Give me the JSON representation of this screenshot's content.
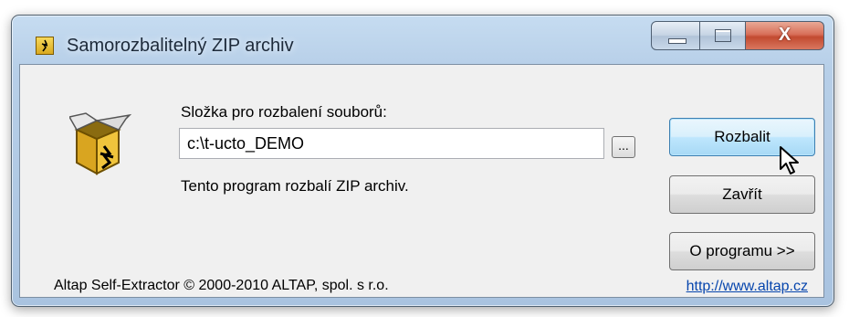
{
  "window": {
    "title": "Samorozbalitelný ZIP archiv",
    "close_glyph": "X"
  },
  "form": {
    "folder_label": "Složka pro rozbalení souborů:",
    "folder_value": "c:\\t-ucto_DEMO",
    "browse_label": "...",
    "info_text": "Tento program rozbalí ZIP archiv."
  },
  "buttons": {
    "extract_label": "Rozbalit",
    "close_label": "Zavřít",
    "about_label": "O programu >>"
  },
  "footer": {
    "copyright": "Altap Self-Extractor © 2000-2010 ALTAP, spol. s r.o.",
    "link": "http://www.altap.cz"
  },
  "icons": {
    "app": "self-extractor-box-icon",
    "package": "open-box-icon",
    "cursor": "mouse-pointer-icon"
  },
  "colors": {
    "titlebar": "#b7cfe8",
    "close_button": "#c24a30",
    "default_button": "#bee6fd",
    "link": "#0645ad"
  }
}
